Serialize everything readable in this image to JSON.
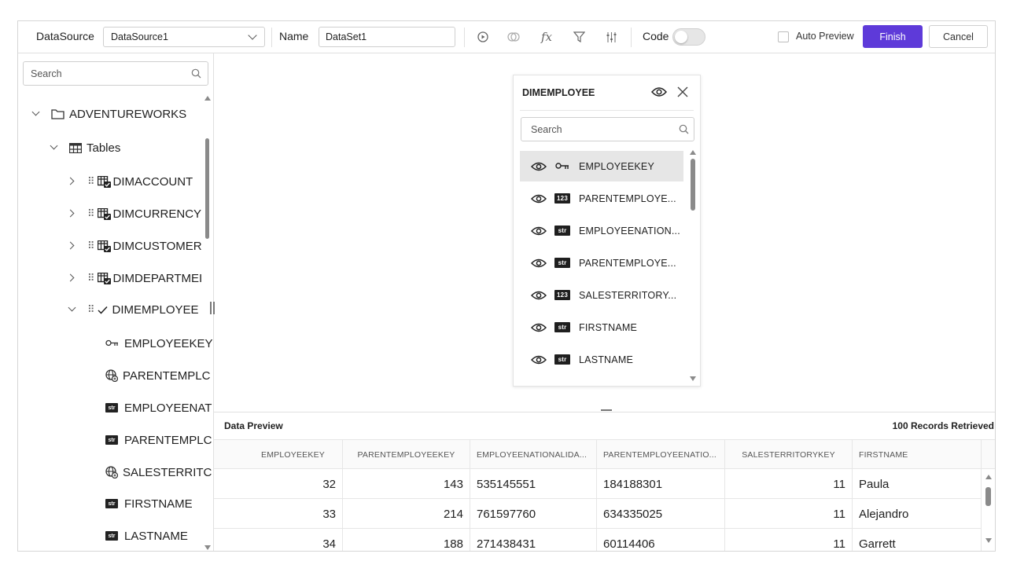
{
  "toolbar": {
    "datasource_label": "DataSource",
    "datasource_value": "DataSource1",
    "name_label": "Name",
    "name_value": "DataSet1",
    "code_label": "Code",
    "auto_preview_label": "Auto Preview",
    "finish_label": "Finish",
    "cancel_label": "Cancel",
    "fx_label": "fx",
    "accent_color": "#5e3ad9"
  },
  "sidebar": {
    "search_placeholder": "Search",
    "root": "ADVENTUREWORKS",
    "tables_label": "Tables",
    "tables": [
      "DIMACCOUNT",
      "DIMCURRENCY",
      "DIMCUSTOMER",
      "DIMDEPARTMEI",
      "DIMEMPLOYEE"
    ],
    "columns": [
      {
        "icon": "key-icon",
        "label": "EMPLOYEEKEY"
      },
      {
        "icon": "globe-icon",
        "label": "PARENTEMPLC"
      },
      {
        "icon": "str-icon",
        "label": "EMPLOYEENAT"
      },
      {
        "icon": "str-icon",
        "label": "PARENTEMPLC"
      },
      {
        "icon": "globe-icon",
        "label": "SALESTERRITC"
      },
      {
        "icon": "str-icon",
        "label": "FIRSTNAME"
      },
      {
        "icon": "str-icon",
        "label": "LASTNAME"
      }
    ]
  },
  "card": {
    "title": "DIMEMPLOYEE",
    "search_placeholder": "Search",
    "type_labels": {
      "num": "123",
      "str": "str"
    },
    "fields": [
      {
        "type": "key",
        "label": "EMPLOYEEKEY"
      },
      {
        "type": "num",
        "label": "PARENTEMPLOYE..."
      },
      {
        "type": "str",
        "label": "EMPLOYEENATION..."
      },
      {
        "type": "str",
        "label": "PARENTEMPLOYE..."
      },
      {
        "type": "num",
        "label": "SALESTERRITORY..."
      },
      {
        "type": "str",
        "label": "FIRSTNAME"
      },
      {
        "type": "str",
        "label": "LASTNAME"
      }
    ]
  },
  "preview": {
    "title": "Data Preview",
    "count_text": "100 Records Retrieved",
    "columns": [
      "EMPLOYEEKEY",
      "PARENTEMPLOYEEKEY",
      "EMPLOYEENATIONALIDA...",
      "PARENTEMPLOYEENATIO...",
      "SALESTERRITORYKEY",
      "FIRSTNAME"
    ],
    "rows": [
      [
        "32",
        "143",
        "535145551",
        "184188301",
        "11",
        "Paula"
      ],
      [
        "33",
        "214",
        "761597760",
        "634335025",
        "11",
        "Alejandro"
      ],
      [
        "34",
        "188",
        "271438431",
        "60114406",
        "11",
        "Garrett"
      ]
    ]
  }
}
